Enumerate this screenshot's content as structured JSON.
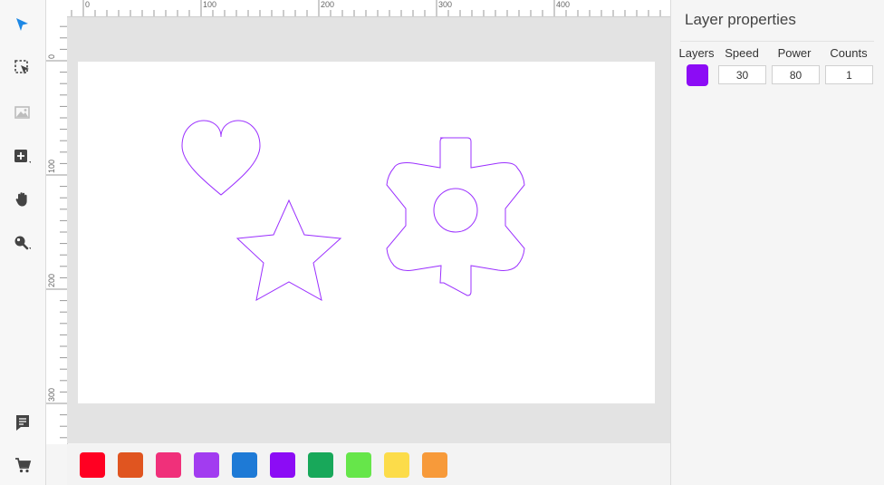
{
  "toolbar": {
    "tools": [
      {
        "name": "select-arrow-icon",
        "color": "#1e88e5"
      },
      {
        "name": "select-region-icon",
        "color": "#444444"
      },
      {
        "name": "image-icon",
        "color": "#bdbdbd"
      },
      {
        "name": "add-shape-icon",
        "color": "#444444"
      },
      {
        "name": "hand-pan-icon",
        "color": "#444444"
      },
      {
        "name": "zoom-icon",
        "color": "#444444"
      },
      {
        "name": "notes-icon",
        "color": "#444444"
      },
      {
        "name": "cart-icon",
        "color": "#444444"
      }
    ]
  },
  "ruler": {
    "top_labels": [
      "0",
      "100",
      "200",
      "300",
      "400"
    ],
    "left_labels": [
      "0",
      "100",
      "200",
      "300"
    ]
  },
  "canvas": {
    "shape_color": "#9b30ff",
    "shapes": [
      "heart",
      "star",
      "gear"
    ]
  },
  "palette": {
    "colors": [
      "#ff0022",
      "#e05520",
      "#f0307a",
      "#a23cf0",
      "#1e7ad6",
      "#8c0cf5",
      "#18a85a",
      "#66e64a",
      "#fcdc4a",
      "#f79a3a"
    ]
  },
  "panel": {
    "title": "Layer properties",
    "headers": {
      "layers": "Layers",
      "speed": "Speed",
      "power": "Power",
      "counts": "Counts"
    },
    "layer": {
      "color": "#8c0cf5",
      "speed": "30",
      "power": "80",
      "counts": "1"
    }
  }
}
